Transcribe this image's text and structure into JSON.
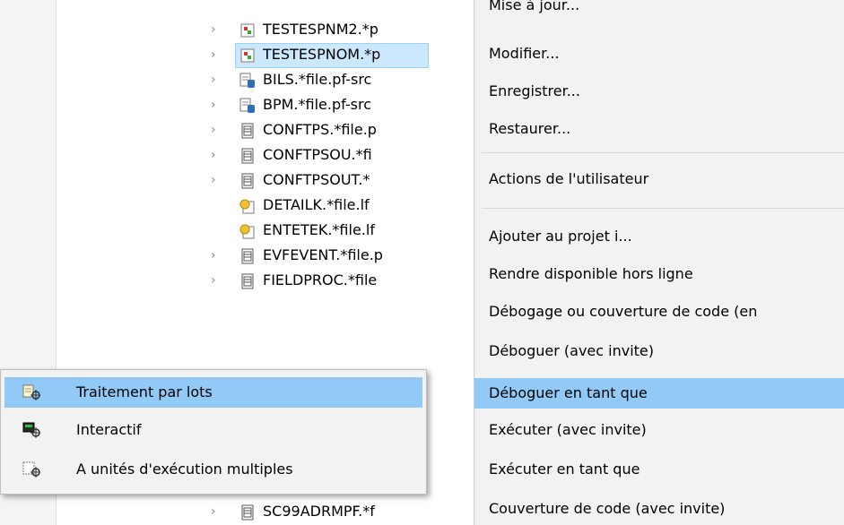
{
  "tree": {
    "items": [
      {
        "label": "TESTESPNM2.*p",
        "icon": "member-icon",
        "chevron": true
      },
      {
        "label": "TESTESPNOM.*p",
        "icon": "member-icon",
        "chevron": true,
        "selected": true
      },
      {
        "label": "BILS.*file.pf-src",
        "icon": "source-file-icon",
        "chevron": true
      },
      {
        "label": "BPM.*file.pf-src",
        "icon": "source-file-icon",
        "chevron": true
      },
      {
        "label": "CONFTPS.*file.p",
        "icon": "file-icon",
        "chevron": true
      },
      {
        "label": "CONFTPSOU.*fi",
        "icon": "file-icon",
        "chevron": true
      },
      {
        "label": "CONFTPSOUT.*",
        "icon": "file-icon",
        "chevron": true
      },
      {
        "label": "DETAILK.*file.lf",
        "icon": "logical-file-icon",
        "chevron": false
      },
      {
        "label": "ENTETEK.*file.lf",
        "icon": "logical-file-icon",
        "chevron": false
      },
      {
        "label": "EVFEVENT.*file.p",
        "icon": "file-icon",
        "chevron": true
      },
      {
        "label": "FIELDPROC.*file",
        "icon": "file-icon",
        "chevron": true
      },
      {
        "label": "SC99ADRMPF.*f",
        "icon": "file-icon",
        "chevron": true
      }
    ]
  },
  "context_menu": {
    "items": [
      "Mise à jour...",
      "Modifier...",
      "Enregistrer...",
      "Restaurer...",
      "Actions de l'utilisateur",
      "Ajouter au projet i...",
      "Rendre disponible hors ligne",
      "Débogage ou couverture de code (en",
      "Déboguer (avec invite)",
      "Déboguer en tant que",
      "Exécuter (avec invite)",
      "Exécuter en tant que",
      "Couverture de code (avec invite)"
    ]
  },
  "submenu": {
    "items": [
      {
        "label": "Traitement par lots",
        "icon": "batch-debug-icon"
      },
      {
        "label": "Interactif",
        "icon": "interactive-debug-icon"
      },
      {
        "label": "A unités d'exécution multiples",
        "icon": "multithread-debug-icon"
      }
    ]
  },
  "colors": {
    "highlight": "#91c9f7",
    "tree_selection": "#cce8ff",
    "menu_bg": "#f2f2f2"
  }
}
